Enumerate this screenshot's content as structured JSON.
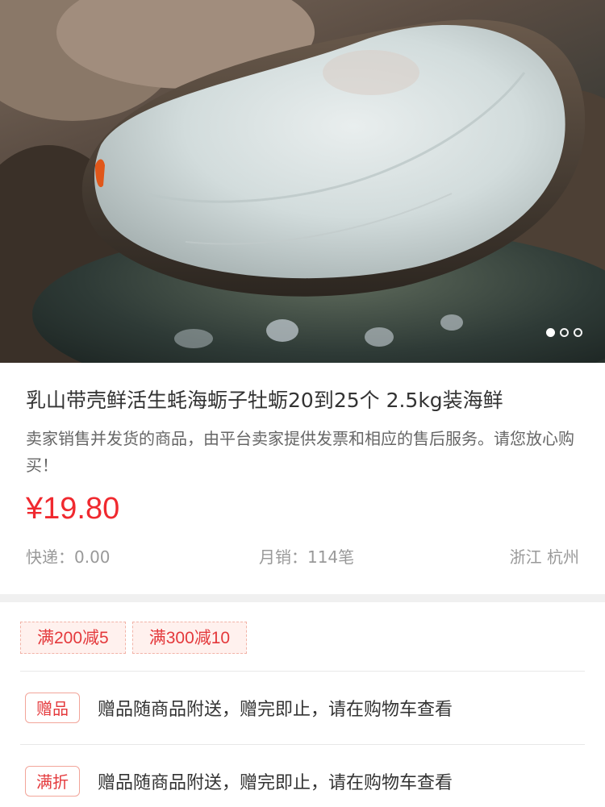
{
  "hero": {
    "image_alt": "oyster-photo",
    "dots": [
      true,
      false,
      false
    ]
  },
  "product": {
    "title": "乳山带壳鲜活生蚝海蛎子牡蛎20到25个 2.5kg装海鲜",
    "description": "卖家销售并发货的商品，由平台卖家提供发票和相应的售后服务。请您放心购买！",
    "price": "¥19.80",
    "shipping": "快递：0.00",
    "monthly_sales": "月销：114笔",
    "location": "浙江 杭州"
  },
  "promotions": {
    "coupons": [
      "满200减5",
      "满300减10"
    ],
    "rows": [
      {
        "tag": "赠品",
        "text": "赠品随商品附送，赠完即止，请在购物车查看"
      },
      {
        "tag": "满折",
        "text": "赠品随商品附送，赠完即止，请在购物车查看"
      }
    ]
  },
  "colors": {
    "price": "#f0292f",
    "accent": "#e4393c",
    "coupon_bg": "#fff1ee"
  }
}
